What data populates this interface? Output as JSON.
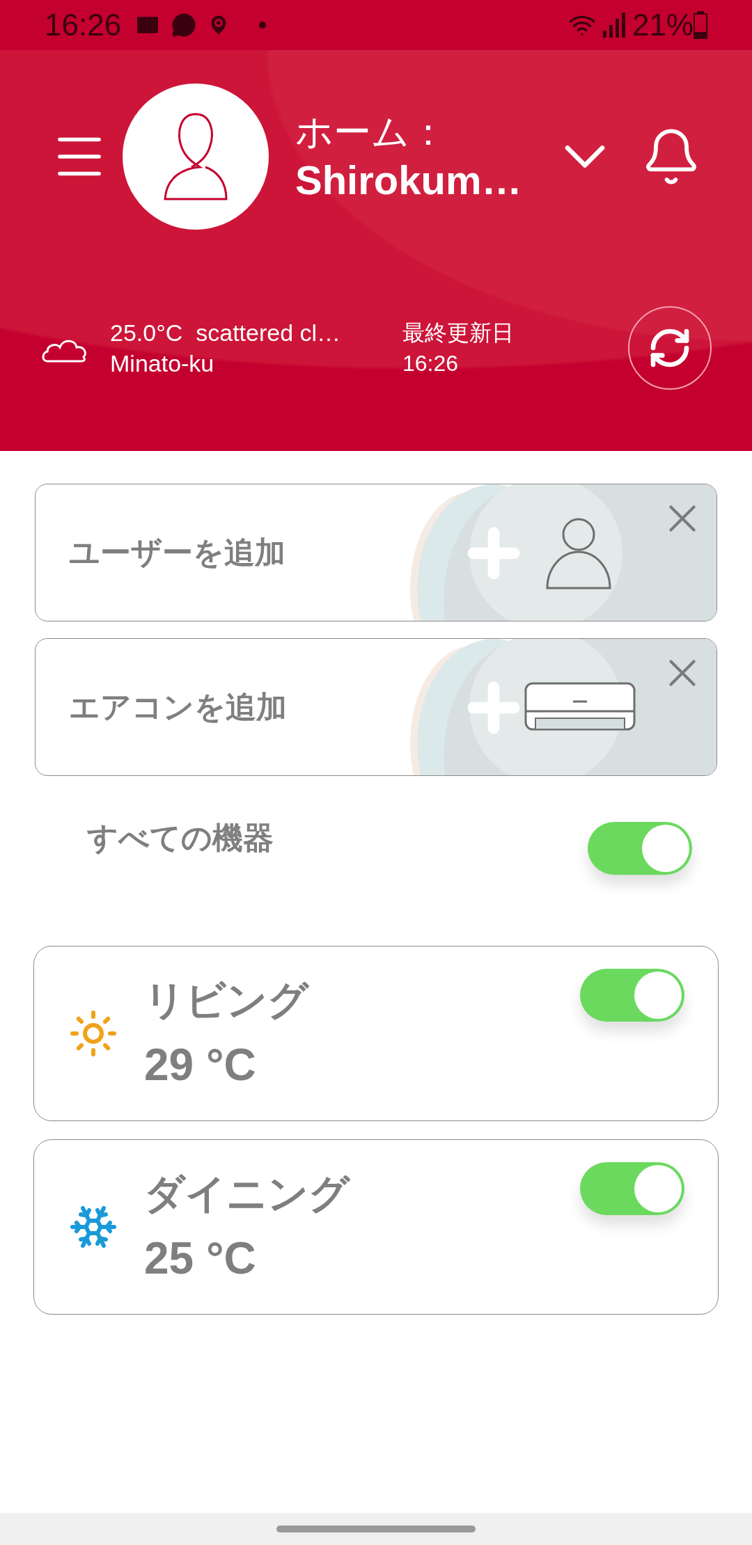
{
  "status_bar": {
    "time": "16:26",
    "battery": "21%"
  },
  "header": {
    "title_line1": "ホーム：",
    "title_line2": "Shirokum…",
    "weather": "25.0°C  scattered cl…",
    "location": "Minato-ku",
    "updated_label": "最終更新日",
    "updated_time": "16:26"
  },
  "add_cards": [
    {
      "kind": "user",
      "label": "ユーザーを追加"
    },
    {
      "kind": "aircon",
      "label": "エアコンを追加"
    }
  ],
  "all_devices": {
    "label": "すべての機器",
    "on": true
  },
  "rooms": [
    {
      "name": "リビング",
      "temperature": "29 °C",
      "kind": "heat",
      "on": true
    },
    {
      "name": "ダイニング",
      "temperature": "25 °C",
      "kind": "cool",
      "on": true
    }
  ]
}
